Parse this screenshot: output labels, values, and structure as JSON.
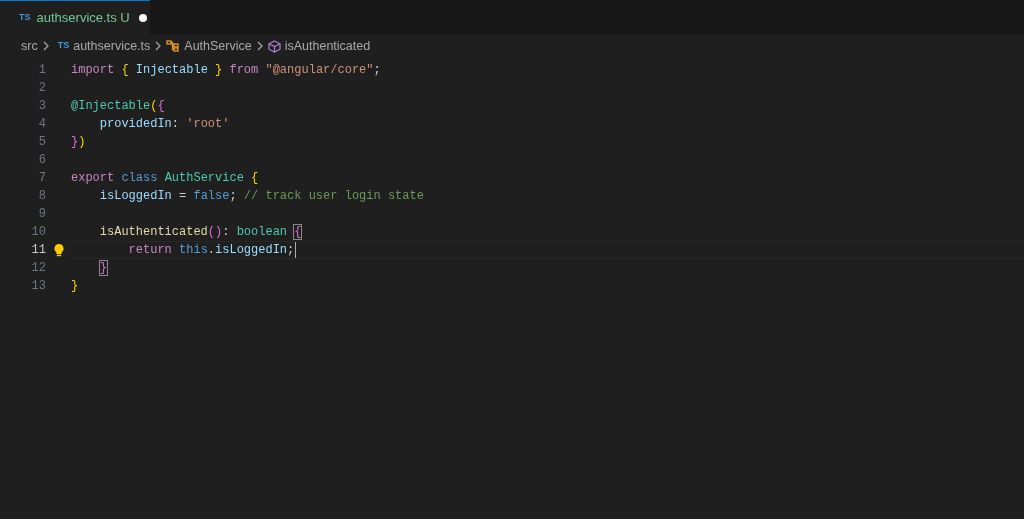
{
  "tabs": [
    {
      "icon": "TS",
      "label": "authservice.ts",
      "status": "U",
      "modified": true,
      "selected": true
    }
  ],
  "breadcrumb": [
    {
      "kind": "folder",
      "label": "src"
    },
    {
      "kind": "file",
      "icon": "TS",
      "label": "authservice.ts"
    },
    {
      "kind": "class",
      "label": "AuthService"
    },
    {
      "kind": "method",
      "label": "isAuthenticated"
    }
  ],
  "lines": [
    {
      "number": "1",
      "current": false,
      "tokens": [
        {
          "kind": "keyword",
          "text": "import "
        },
        {
          "kind": "brace",
          "text": "{ "
        },
        {
          "kind": "variable",
          "text": "Injectable"
        },
        {
          "kind": "brace",
          "text": " } "
        },
        {
          "kind": "keyword",
          "text": "from "
        },
        {
          "kind": "string",
          "text": "\"@angular/core\""
        },
        {
          "kind": "plain",
          "text": ";"
        }
      ]
    },
    {
      "number": "2",
      "current": false
    },
    {
      "number": "3",
      "current": false,
      "tokens": [
        {
          "kind": "type",
          "text": "@Injectable"
        },
        {
          "kind": "brace",
          "text": "("
        },
        {
          "kind": "brace2",
          "text": "{"
        }
      ]
    },
    {
      "number": "4",
      "current": false,
      "tokens": [
        {
          "kind": "variable",
          "text": "    providedIn"
        },
        {
          "kind": "plain",
          "text": ": "
        },
        {
          "kind": "string",
          "text": "'root'"
        }
      ]
    },
    {
      "number": "5",
      "current": false,
      "tokens": [
        {
          "kind": "brace2",
          "text": "}"
        },
        {
          "kind": "brace",
          "text": ")"
        }
      ]
    },
    {
      "number": "6",
      "current": false
    },
    {
      "number": "7",
      "current": false,
      "tokens": [
        {
          "kind": "keyword",
          "text": "export "
        },
        {
          "kind": "storage",
          "text": "class "
        },
        {
          "kind": "type",
          "text": "AuthService"
        },
        {
          "kind": "brace",
          "text": " {"
        }
      ]
    },
    {
      "number": "8",
      "current": false,
      "tokens": [
        {
          "kind": "variable",
          "text": "    isLoggedIn"
        },
        {
          "kind": "plain",
          "text": " = "
        },
        {
          "kind": "storage",
          "text": "false"
        },
        {
          "kind": "plain",
          "text": "; "
        },
        {
          "kind": "comment",
          "text": "// track user login state"
        }
      ]
    },
    {
      "number": "9",
      "current": false
    },
    {
      "number": "10",
      "current": false,
      "tokens": [
        {
          "kind": "function",
          "text": "    isAuthenticated"
        },
        {
          "kind": "brace2",
          "text": "()"
        },
        {
          "kind": "plain",
          "text": ": "
        },
        {
          "kind": "type",
          "text": "boolean "
        },
        {
          "kind": "brace2",
          "text": "{",
          "matched": true
        }
      ]
    },
    {
      "number": "11",
      "current": true,
      "tokens": [
        {
          "kind": "keyword",
          "text": "        return "
        },
        {
          "kind": "storage",
          "text": "this"
        },
        {
          "kind": "plain",
          "text": "."
        },
        {
          "kind": "variable",
          "text": "isLoggedIn"
        },
        {
          "kind": "plain",
          "text": ";"
        }
      ]
    },
    {
      "number": "12",
      "current": false,
      "tokens": [
        {
          "kind": "brace2",
          "text": "    }",
          "matched": true
        }
      ]
    },
    {
      "number": "13",
      "current": false,
      "tokens": [
        {
          "kind": "brace",
          "text": "}"
        }
      ]
    }
  ]
}
